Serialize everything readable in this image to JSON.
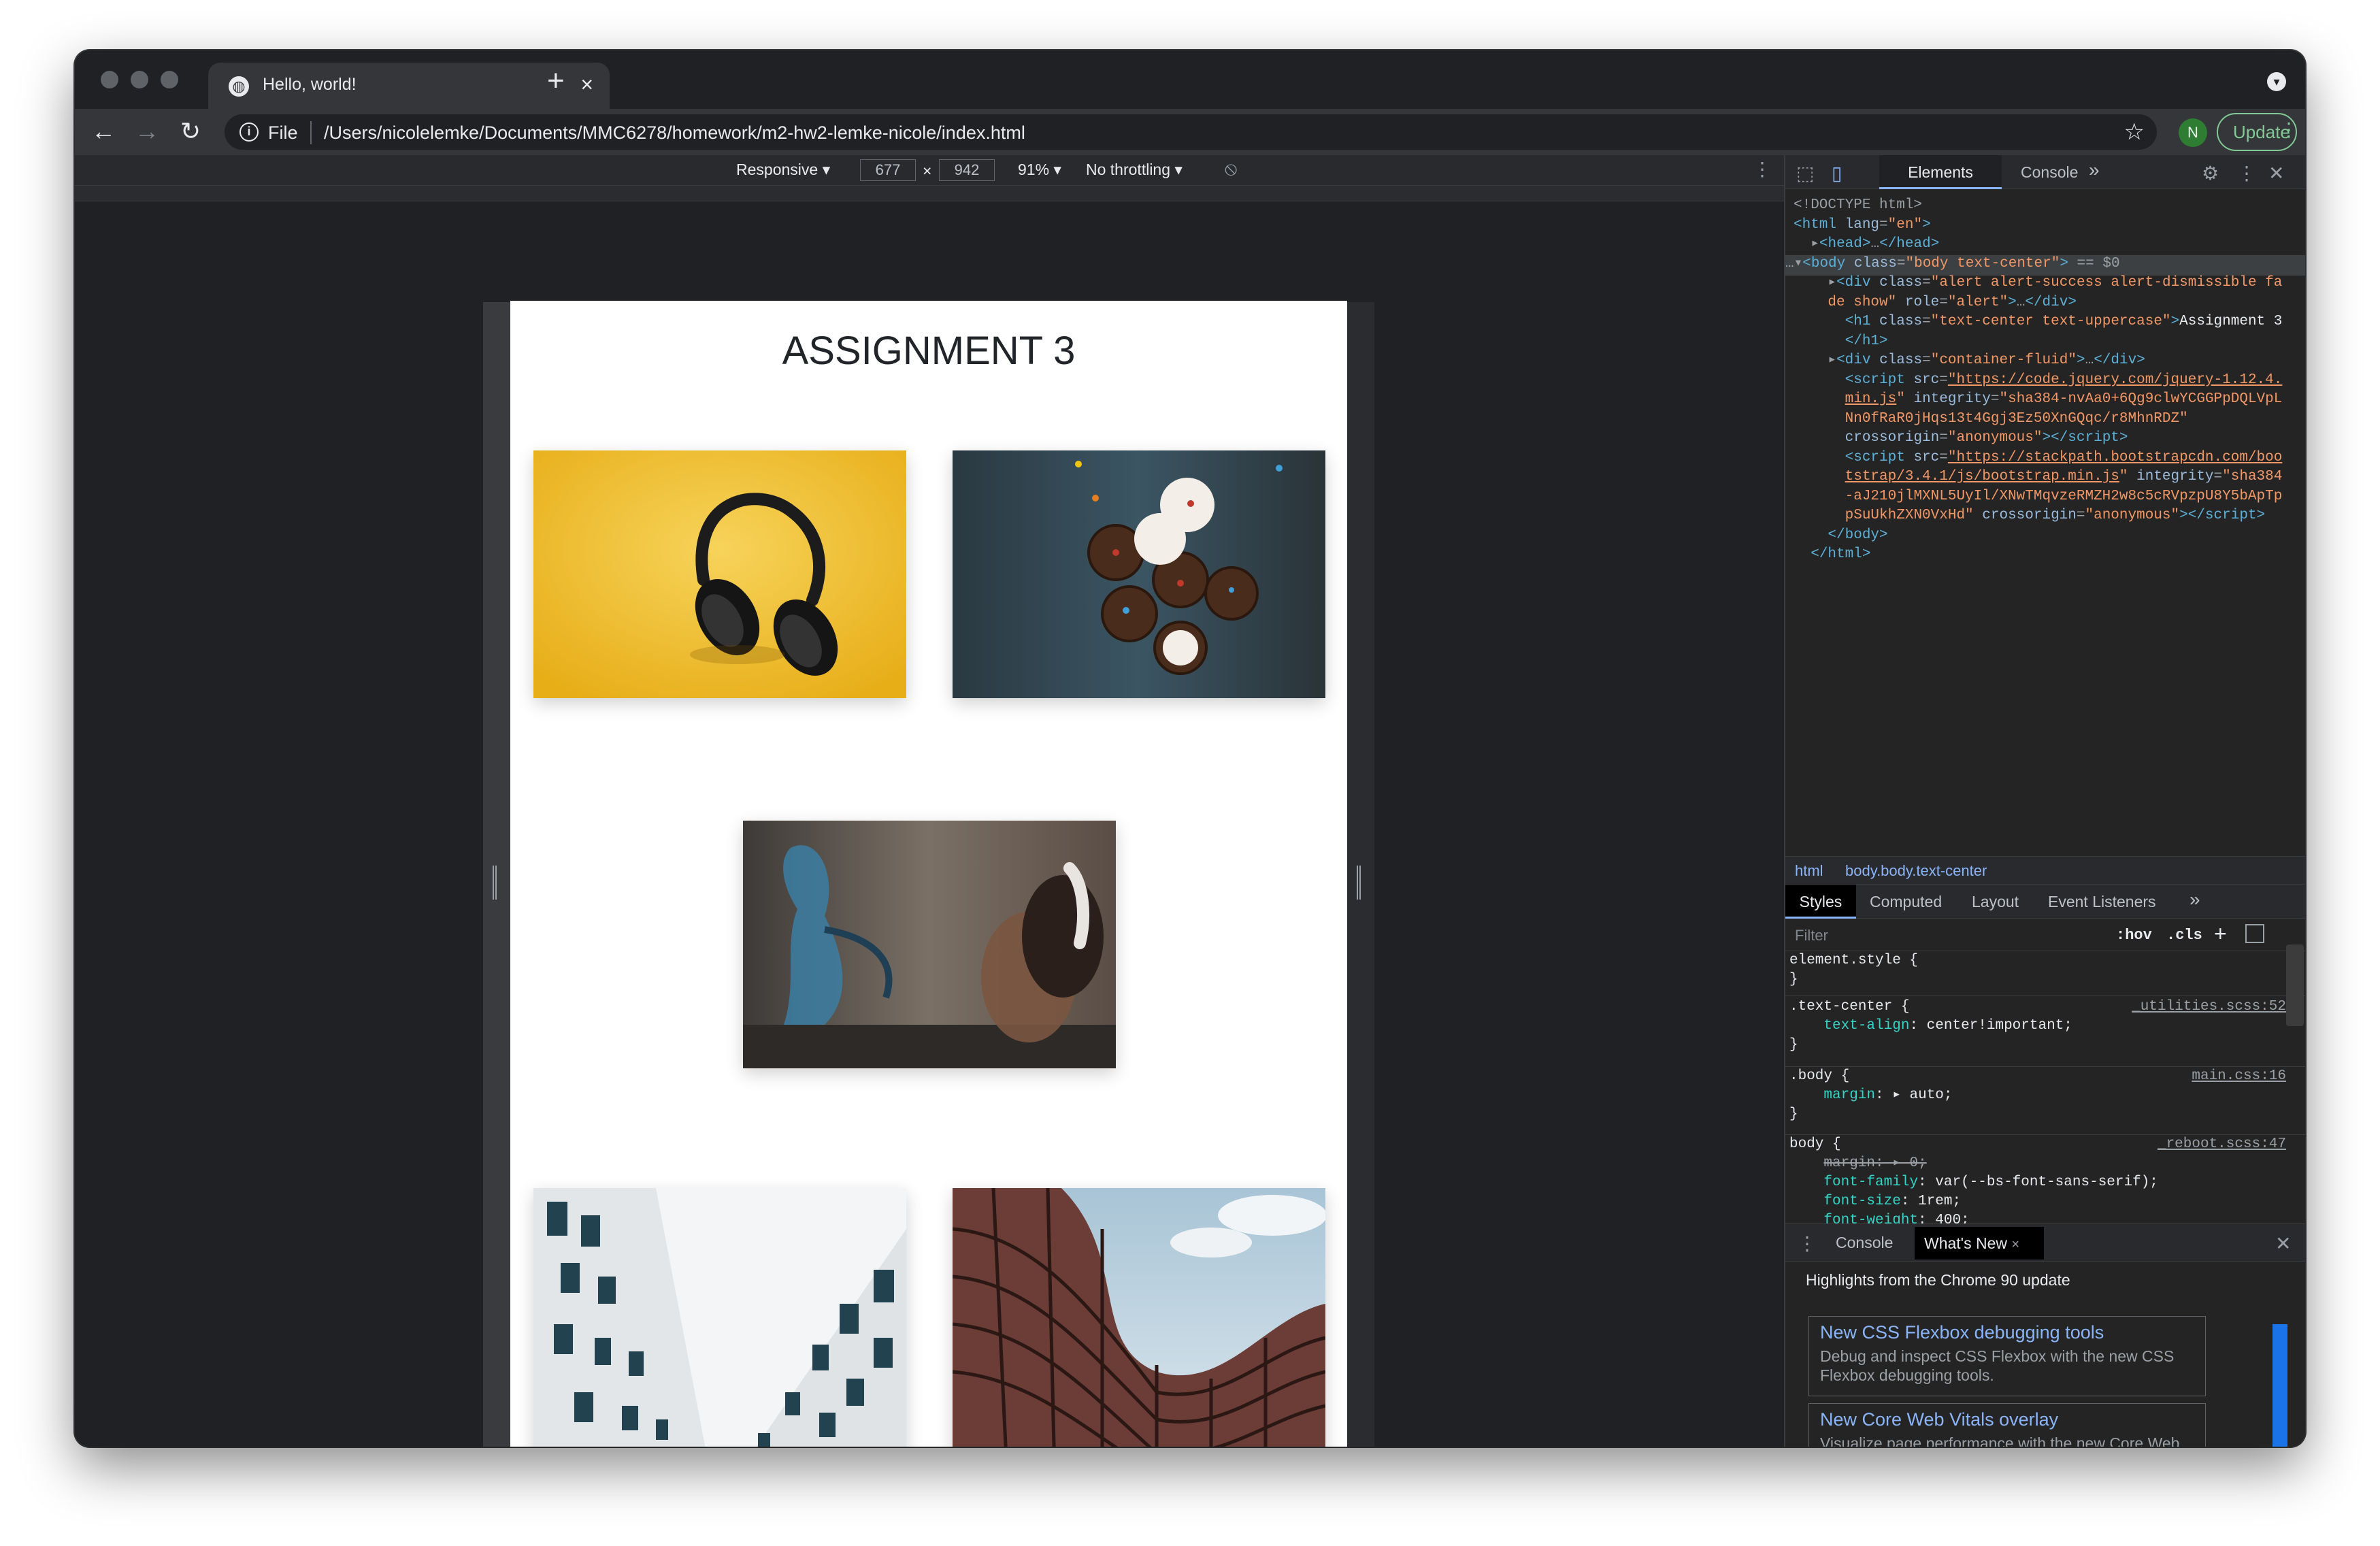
{
  "browser": {
    "tab_title": "Hello, world!",
    "tab_close": "×",
    "new_tab": "+",
    "nav": {
      "back": "←",
      "forward": "→",
      "reload": "↻"
    },
    "omnibox": {
      "info": "i",
      "scheme_label": "File",
      "url": "/Users/nicolelemke/Documents/MMC6278/homework/m2-hw2-lemke-nicole/index.html"
    },
    "star": "☆",
    "avatar": "N",
    "update_label": "Update",
    "menu": "⋮"
  },
  "device_toolbar": {
    "mode": "Responsive ▾",
    "width": "677",
    "times": "×",
    "height": "942",
    "zoom": "91% ▾",
    "throttle": "No throttling ▾",
    "rotate": "⦸",
    "more": "⋮"
  },
  "page": {
    "heading": "ASSIGNMENT 3",
    "images": [
      {
        "name": "headphones-on-yellow",
        "color": "#f2c12e"
      },
      {
        "name": "cupcakes-on-dark-table",
        "color": "#2f3e46"
      },
      {
        "name": "graffiti-woman-headphones",
        "color": "#5b5048"
      },
      {
        "name": "white-building-facade",
        "color": "#d9dde0"
      },
      {
        "name": "curved-building",
        "color": "#9fb8c9"
      }
    ]
  },
  "devtools": {
    "tabs": [
      "Elements",
      "Console",
      "»"
    ],
    "dom_lines": [
      {
        "indent": 0,
        "html": "<span class='cm'>&lt;!DOCTYPE html&gt;</span>"
      },
      {
        "indent": 0,
        "html": "<span class='tag'>&lt;html</span> <span class='at'>lang</span>=<span class='av'>\"en\"</span><span class='tag'>&gt;</span>"
      }
    ],
    "breadcrumb": [
      "html",
      "body.body.text-center"
    ],
    "style_tabs": [
      "Styles",
      "Computed",
      "Layout",
      "Event Listeners",
      "»"
    ],
    "filter_placeholder": "Filter",
    "filter_tools": [
      ":hov",
      ".cls",
      "+"
    ],
    "drawer_tabs": [
      "Console",
      "What's New"
    ],
    "whats_new_close": "×",
    "highlights": "Highlights from the Chrome 90 update",
    "cards": [
      {
        "title": "New CSS Flexbox debugging tools",
        "desc": "Debug and inspect CSS Flexbox with the new CSS Flexbox debugging tools."
      },
      {
        "title": "New Core Web Vitals overlay",
        "desc": "Visualize page performance with the new Core Web Vitals overlay."
      }
    ]
  }
}
